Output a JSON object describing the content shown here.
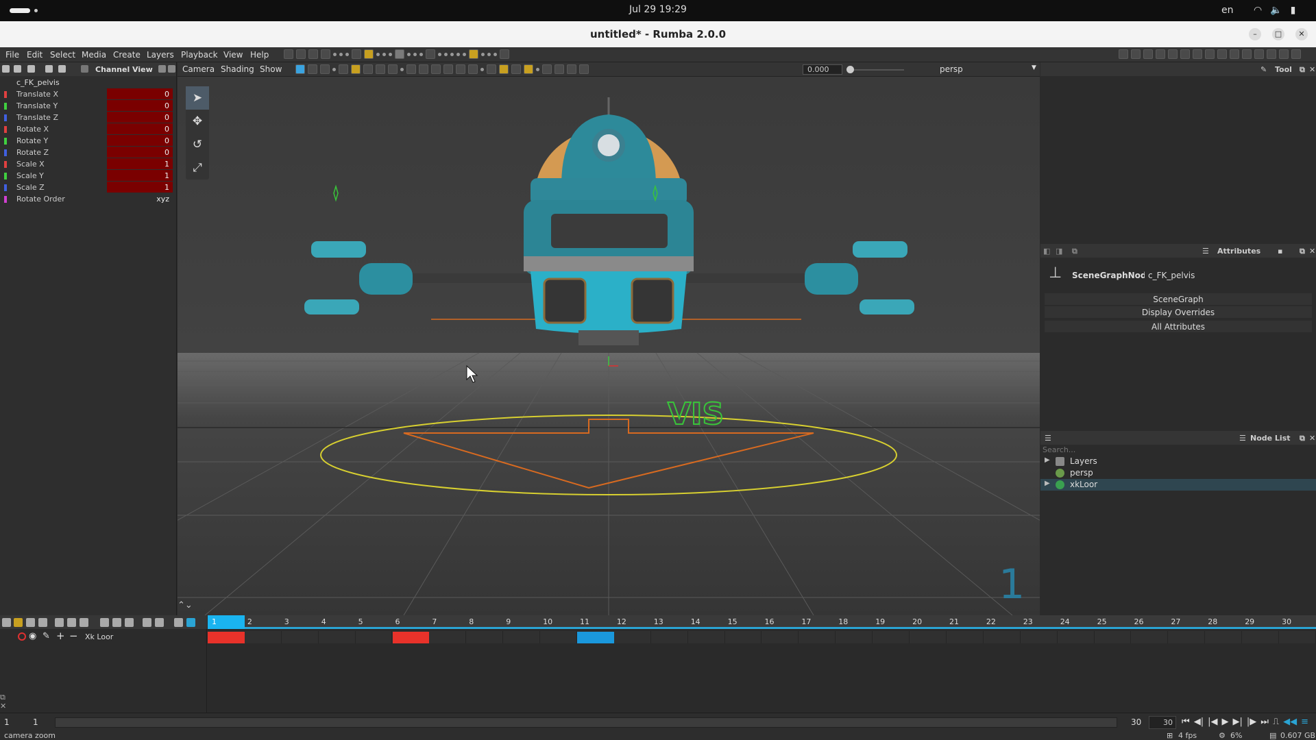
{
  "system": {
    "clock": "Jul 29  19:29",
    "lang": "en"
  },
  "window": {
    "title": "untitled* - Rumba 2.0.0"
  },
  "menu": [
    "File",
    "Edit",
    "Select",
    "Media",
    "Create",
    "Layers",
    "Playback",
    "View",
    "Help"
  ],
  "channel_view": {
    "title": "Channel View",
    "node": "c_FK_pelvis",
    "channels": [
      {
        "label": "Translate X",
        "value": "0",
        "color": "#e04040"
      },
      {
        "label": "Translate Y",
        "value": "0",
        "color": "#40d040"
      },
      {
        "label": "Translate Z",
        "value": "0",
        "color": "#4060e0"
      },
      {
        "label": "Rotate X",
        "value": "0",
        "color": "#e04040"
      },
      {
        "label": "Rotate Y",
        "value": "0",
        "color": "#40d040"
      },
      {
        "label": "Rotate Z",
        "value": "0",
        "color": "#4060e0"
      },
      {
        "label": "Scale X",
        "value": "1",
        "color": "#e04040"
      },
      {
        "label": "Scale Y",
        "value": "1",
        "color": "#40d040"
      },
      {
        "label": "Scale Z",
        "value": "1",
        "color": "#4060e0"
      },
      {
        "label": "Rotate Order",
        "value": "xyz",
        "color": "#d040d0"
      }
    ]
  },
  "viewport": {
    "menu": [
      "Camera",
      "Shading",
      "Show"
    ],
    "time_value": "0.000",
    "camera": "persp",
    "overlay_text": "VIS",
    "frame": "1"
  },
  "tool_panel": {
    "title": "Tool"
  },
  "attributes": {
    "title": "Attributes",
    "node_type": "SceneGraphNode",
    "node_name": "c_FK_pelvis",
    "buttons": [
      "SceneGraph",
      "Display Overrides",
      "All Attributes"
    ]
  },
  "node_list": {
    "title": "Node List",
    "search_placeholder": "Search...",
    "items": [
      {
        "label": "Layers",
        "expandable": true,
        "icon": "layers-icon"
      },
      {
        "label": "persp",
        "expandable": false,
        "icon": "camera-icon"
      },
      {
        "label": "xkLoor",
        "expandable": true,
        "icon": "character-icon"
      }
    ]
  },
  "timeline": {
    "layer": "Xk Loor",
    "current_frame": "1",
    "ticks": [
      "1",
      "2",
      "3",
      "4",
      "5",
      "6",
      "7",
      "8",
      "9",
      "10",
      "11",
      "12",
      "13",
      "14",
      "15",
      "16",
      "17",
      "18",
      "19",
      "20",
      "21",
      "22",
      "23",
      "24",
      "25",
      "26",
      "27",
      "28",
      "29",
      "30"
    ],
    "keys": [
      {
        "frame": 1,
        "color": "#e8322a"
      },
      {
        "frame": 6,
        "color": "#e8322a"
      },
      {
        "frame": 11,
        "color": "#1a98dc"
      }
    ],
    "start": "1",
    "start2": "1",
    "end": "30",
    "end2": "30"
  },
  "status": {
    "message": "camera zoom",
    "fps": "4 fps",
    "percent": "6%",
    "memory": "0.607 GB"
  }
}
